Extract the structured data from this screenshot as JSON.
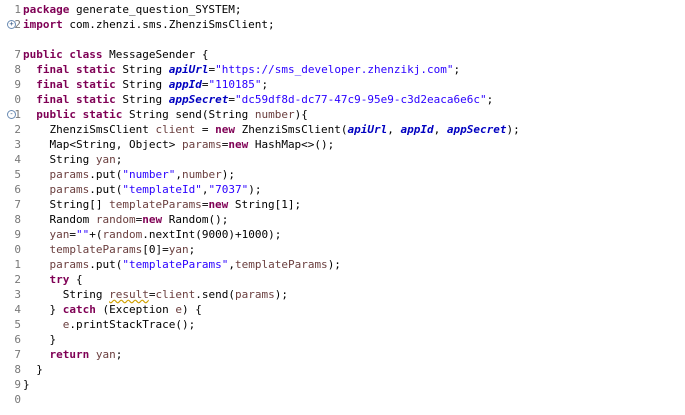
{
  "editor": {
    "line_numbers": [
      "1",
      "2",
      "",
      "7",
      "8",
      "9",
      "0",
      "1",
      "2",
      "3",
      "4",
      "5",
      "6",
      "7",
      "8",
      "9",
      "0",
      "1",
      "2",
      "3",
      "4",
      "5",
      "6",
      "7",
      "8",
      "9",
      "0"
    ],
    "fold_markers": [
      "+",
      "-"
    ],
    "lines": [
      [
        {
          "t": "package",
          "c": "kw"
        },
        {
          "t": " generate_question_SYSTEM;"
        }
      ],
      [
        {
          "t": "import",
          "c": "kw"
        },
        {
          "t": " com.zhenzi.sms.ZhenziSmsClient;"
        }
      ],
      [
        {
          "t": ""
        }
      ],
      [
        {
          "t": "public",
          "c": "kw"
        },
        {
          "t": " "
        },
        {
          "t": "class",
          "c": "kw"
        },
        {
          "t": " MessageSender {"
        }
      ],
      [
        {
          "t": "  "
        },
        {
          "t": "final",
          "c": "kw"
        },
        {
          "t": " "
        },
        {
          "t": "static",
          "c": "kw"
        },
        {
          "t": " String "
        },
        {
          "t": "apiUrl",
          "c": "fld"
        },
        {
          "t": "="
        },
        {
          "t": "\"https://sms_developer.zhenzikj.com\"",
          "c": "str"
        },
        {
          "t": ";"
        }
      ],
      [
        {
          "t": "  "
        },
        {
          "t": "final",
          "c": "kw"
        },
        {
          "t": " "
        },
        {
          "t": "static",
          "c": "kw"
        },
        {
          "t": " String "
        },
        {
          "t": "appId",
          "c": "fld"
        },
        {
          "t": "="
        },
        {
          "t": "\"110185\"",
          "c": "str"
        },
        {
          "t": ";"
        }
      ],
      [
        {
          "t": "  "
        },
        {
          "t": "final",
          "c": "kw"
        },
        {
          "t": " "
        },
        {
          "t": "static",
          "c": "kw"
        },
        {
          "t": " String "
        },
        {
          "t": "appSecret",
          "c": "fld"
        },
        {
          "t": "="
        },
        {
          "t": "\"dc59df8d-dc77-47c9-95e9-c3d2eaca6e6c\"",
          "c": "str"
        },
        {
          "t": ";"
        }
      ],
      [
        {
          "t": "  "
        },
        {
          "t": "public",
          "c": "kw"
        },
        {
          "t": " "
        },
        {
          "t": "static",
          "c": "kw"
        },
        {
          "t": " String send(String "
        },
        {
          "t": "number",
          "c": "var"
        },
        {
          "t": "){"
        }
      ],
      [
        {
          "t": "    ZhenziSmsClient "
        },
        {
          "t": "client",
          "c": "var"
        },
        {
          "t": " = "
        },
        {
          "t": "new",
          "c": "kw"
        },
        {
          "t": " ZhenziSmsClient("
        },
        {
          "t": "apiUrl",
          "c": "fld"
        },
        {
          "t": ", "
        },
        {
          "t": "appId",
          "c": "fld"
        },
        {
          "t": ", "
        },
        {
          "t": "appSecret",
          "c": "fld"
        },
        {
          "t": ");"
        }
      ],
      [
        {
          "t": "    Map<String, Object> "
        },
        {
          "t": "params",
          "c": "var"
        },
        {
          "t": "="
        },
        {
          "t": "new",
          "c": "kw"
        },
        {
          "t": " HashMap<>();"
        }
      ],
      [
        {
          "t": "    String "
        },
        {
          "t": "yan",
          "c": "var"
        },
        {
          "t": ";"
        }
      ],
      [
        {
          "t": "    "
        },
        {
          "t": "params",
          "c": "var"
        },
        {
          "t": ".put("
        },
        {
          "t": "\"number\"",
          "c": "str"
        },
        {
          "t": ","
        },
        {
          "t": "number",
          "c": "var"
        },
        {
          "t": ");"
        }
      ],
      [
        {
          "t": "    "
        },
        {
          "t": "params",
          "c": "var"
        },
        {
          "t": ".put("
        },
        {
          "t": "\"templateId\"",
          "c": "str"
        },
        {
          "t": ","
        },
        {
          "t": "\"7037\"",
          "c": "str"
        },
        {
          "t": ");"
        }
      ],
      [
        {
          "t": "    String[] "
        },
        {
          "t": "templateParams",
          "c": "var"
        },
        {
          "t": "="
        },
        {
          "t": "new",
          "c": "kw"
        },
        {
          "t": " String[1];"
        }
      ],
      [
        {
          "t": "    Random "
        },
        {
          "t": "random",
          "c": "var"
        },
        {
          "t": "="
        },
        {
          "t": "new",
          "c": "kw"
        },
        {
          "t": " Random();"
        }
      ],
      [
        {
          "t": "    "
        },
        {
          "t": "yan",
          "c": "var"
        },
        {
          "t": "="
        },
        {
          "t": "\"\"",
          "c": "str"
        },
        {
          "t": "+("
        },
        {
          "t": "random",
          "c": "var"
        },
        {
          "t": ".nextInt(9000)+1000);"
        }
      ],
      [
        {
          "t": "    "
        },
        {
          "t": "templateParams",
          "c": "var"
        },
        {
          "t": "[0]="
        },
        {
          "t": "yan",
          "c": "var"
        },
        {
          "t": ";"
        }
      ],
      [
        {
          "t": "    "
        },
        {
          "t": "params",
          "c": "var"
        },
        {
          "t": ".put("
        },
        {
          "t": "\"templateParams\"",
          "c": "str"
        },
        {
          "t": ","
        },
        {
          "t": "templateParams",
          "c": "var"
        },
        {
          "t": ");"
        }
      ],
      [
        {
          "t": "    "
        },
        {
          "t": "try",
          "c": "kw"
        },
        {
          "t": " {"
        }
      ],
      [
        {
          "t": "      String "
        },
        {
          "t": "result",
          "c": "var warn"
        },
        {
          "t": "="
        },
        {
          "t": "client",
          "c": "var"
        },
        {
          "t": ".send("
        },
        {
          "t": "params",
          "c": "var"
        },
        {
          "t": ");"
        }
      ],
      [
        {
          "t": "    } "
        },
        {
          "t": "catch",
          "c": "kw"
        },
        {
          "t": " (Exception "
        },
        {
          "t": "e",
          "c": "var"
        },
        {
          "t": ") {"
        }
      ],
      [
        {
          "t": "      "
        },
        {
          "t": "e",
          "c": "var"
        },
        {
          "t": ".printStackTrace();"
        }
      ],
      [
        {
          "t": "    }"
        }
      ],
      [
        {
          "t": "    "
        },
        {
          "t": "return",
          "c": "kw"
        },
        {
          "t": " "
        },
        {
          "t": "yan",
          "c": "var"
        },
        {
          "t": ";"
        }
      ],
      [
        {
          "t": "  }"
        }
      ],
      [
        {
          "t": "}"
        }
      ],
      [
        {
          "t": ""
        }
      ]
    ]
  }
}
